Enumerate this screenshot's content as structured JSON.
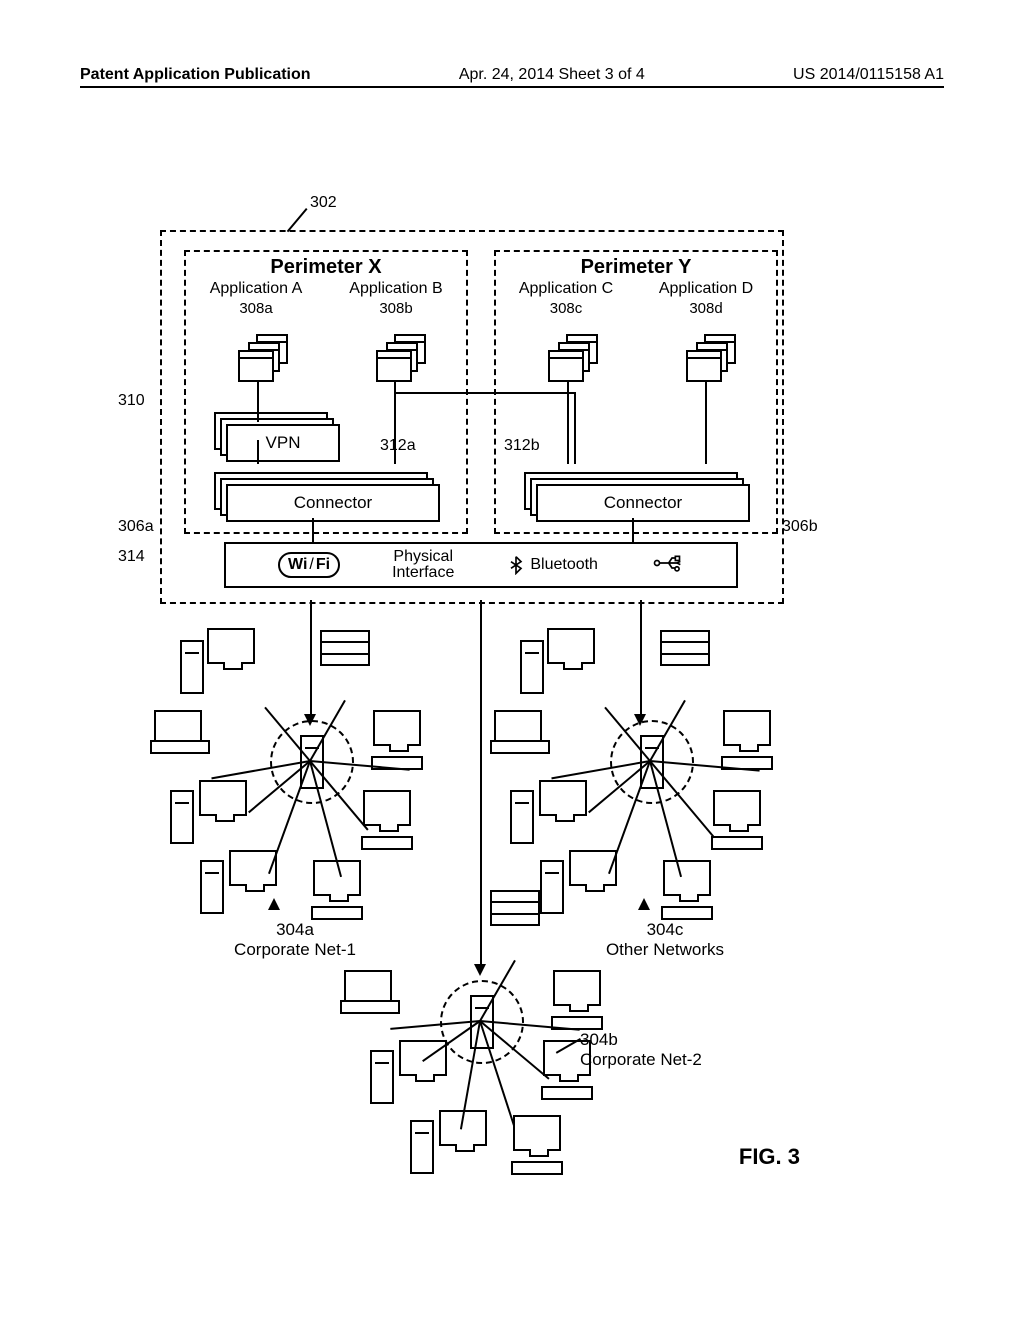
{
  "header": {
    "left": "Patent Application Publication",
    "center": "Apr. 24, 2014  Sheet 3 of 4",
    "right": "US 2014/0115158 A1"
  },
  "device": {
    "ref": "302",
    "perimeters": {
      "x": {
        "title": "Perimeter X",
        "ref": "306a",
        "apps": [
          {
            "label": "Application A",
            "ref": "308a"
          },
          {
            "label": "Application B",
            "ref": "308b"
          }
        ],
        "vpn": {
          "label": "VPN",
          "ref": "310"
        },
        "connector": {
          "label": "Connector",
          "ref": "312a"
        }
      },
      "y": {
        "title": "Perimeter Y",
        "ref": "306b",
        "apps": [
          {
            "label": "Application C",
            "ref": "308c"
          },
          {
            "label": "Application D",
            "ref": "308d"
          }
        ],
        "connector": {
          "label": "Connector",
          "ref": "312b"
        }
      }
    },
    "physical": {
      "ref": "314",
      "label": "Physical\nInterface",
      "wifi": "Wi / Fi",
      "bluetooth": "Bluetooth"
    }
  },
  "networks": {
    "a": {
      "ref": "304a",
      "label": "Corporate Net-1"
    },
    "b": {
      "ref": "304b",
      "label": "Corporate Net-2"
    },
    "c": {
      "ref": "304c",
      "label": "Other Networks"
    }
  },
  "figure": "FIG. 3"
}
